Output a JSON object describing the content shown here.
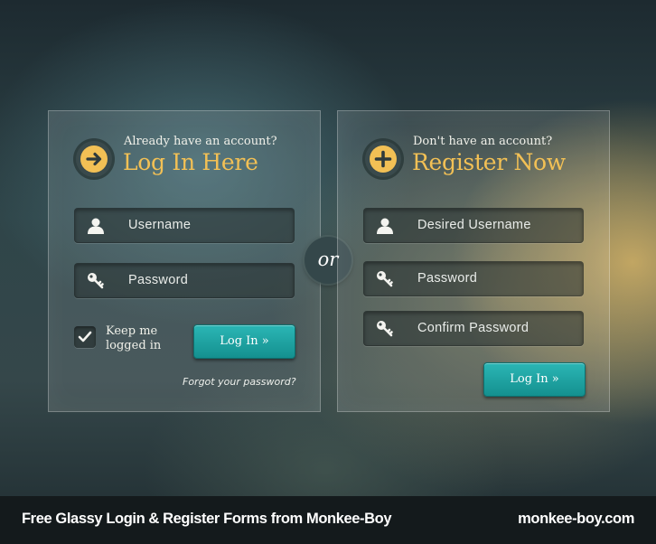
{
  "login": {
    "subtitle": "Already have an account?",
    "title": "Log In Here",
    "username_placeholder": "Username",
    "password_placeholder": "Password",
    "keep_logged_in_label": "Keep me logged in",
    "keep_logged_in_checked": true,
    "submit_label": "Log In »",
    "forgot_link": "Forgot your password?"
  },
  "divider": {
    "label": "or"
  },
  "register": {
    "subtitle": "Don't have an account?",
    "title": "Register Now",
    "username_placeholder": "Desired Username",
    "password_placeholder": "Password",
    "confirm_placeholder": "Confirm Password",
    "submit_label": "Log In »"
  },
  "footer": {
    "left_text": "Free Glassy Login & Register Forms from Monkee-Boy",
    "right_text": "monkee-boy.com"
  },
  "icons": {
    "login_header": "arrow-right-circle-icon",
    "register_header": "plus-circle-icon",
    "username": "user-icon",
    "password": "key-icon",
    "checkbox": "check-icon"
  },
  "colors": {
    "accent_yellow": "#f2c055",
    "button_teal": "#1aa3a2"
  }
}
